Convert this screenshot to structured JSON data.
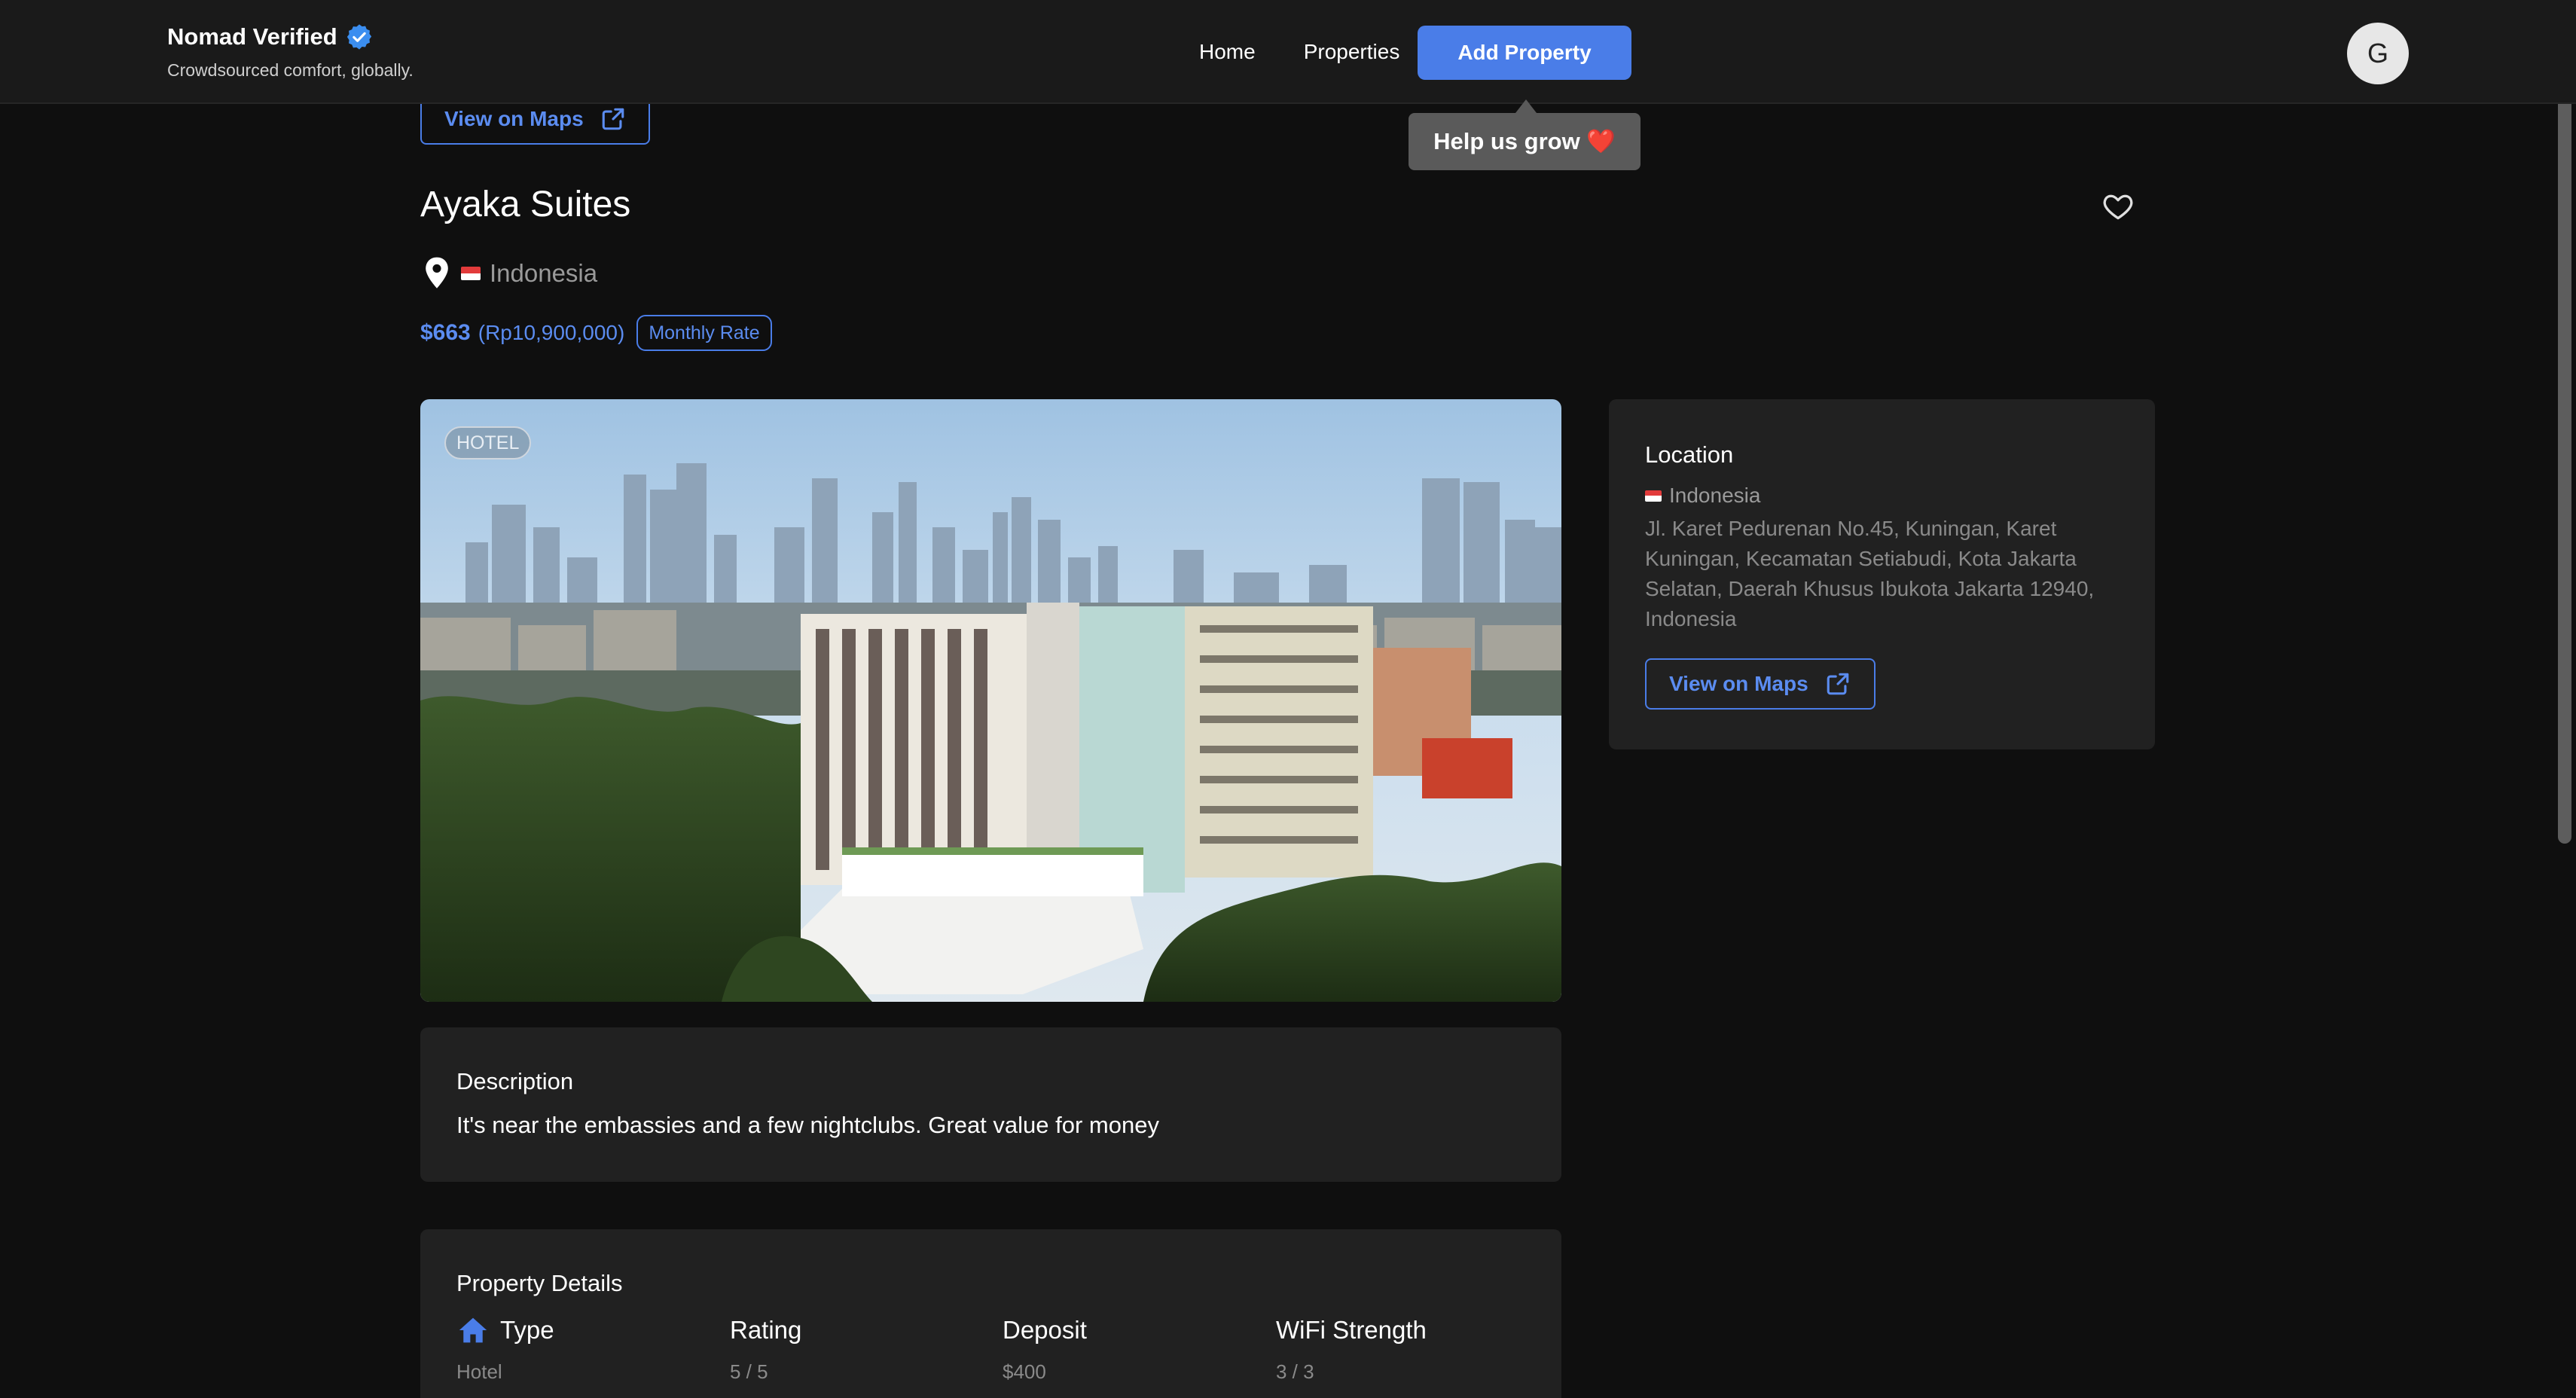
{
  "nav": {
    "brand_title": "Nomad Verified",
    "brand_tagline": "Crowdsourced comfort, globally.",
    "links": [
      "Home",
      "Properties"
    ],
    "add_button": "Add Property",
    "avatar_initial": "G",
    "tooltip": "Help us grow ❤️"
  },
  "property": {
    "view_maps_label": "View on Maps",
    "name": "Ayaka Suites",
    "country": "Indonesia",
    "price_usd": "$663",
    "price_local": "(Rp10,900,000)",
    "rate_badge": "Monthly Rate",
    "type_badge": "HOTEL"
  },
  "description": {
    "title": "Description",
    "text": "It's near the embassies and a few nightclubs. Great value for money"
  },
  "details": {
    "title": "Property Details",
    "items": [
      {
        "label": "Type",
        "value": "Hotel"
      },
      {
        "label": "Rating",
        "value": "5 / 5"
      },
      {
        "label": "Deposit",
        "value": "$400"
      },
      {
        "label": "WiFi Strength",
        "value": "3 / 3"
      }
    ]
  },
  "location": {
    "title": "Location",
    "country": "Indonesia",
    "address": "Jl. Karet Pedurenan No.45, Kuningan, Karet Kuningan, Kecamatan Setiabudi, Kota Jakarta Selatan, Daerah Khusus Ibukota Jakarta 12940, Indonesia",
    "view_maps_label": "View on Maps"
  },
  "colors": {
    "accent": "#4a7de8",
    "background": "#0f0f0f",
    "card": "#212121",
    "navbar": "#1a1a1a"
  }
}
